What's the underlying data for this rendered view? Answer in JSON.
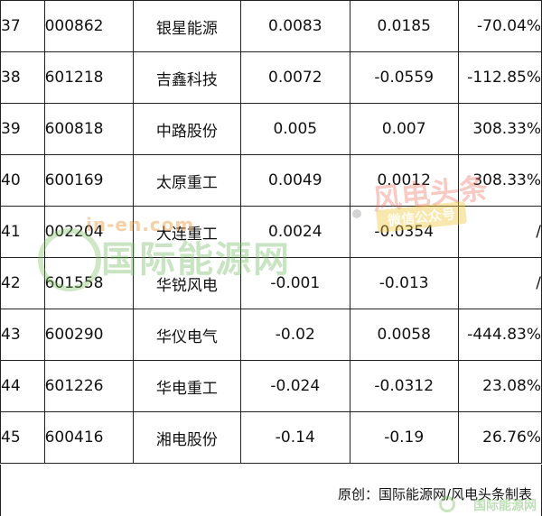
{
  "table": {
    "rows": [
      {
        "rank": "37",
        "code": "000862",
        "name": "银星能源",
        "v1": "0.0083",
        "v2": "0.0185",
        "change": "-70.04%"
      },
      {
        "rank": "38",
        "code": "601218",
        "name": "吉鑫科技",
        "v1": "0.0072",
        "v2": "-0.0559",
        "change": "-112.85%"
      },
      {
        "rank": "39",
        "code": "600818",
        "name": "中路股份",
        "v1": "0.005",
        "v2": "0.007",
        "change": "308.33%"
      },
      {
        "rank": "40",
        "code": "600169",
        "name": "太原重工",
        "v1": "0.0049",
        "v2": "0.0012",
        "change": "308.33%"
      },
      {
        "rank": "41",
        "code": "002204",
        "name": "大连重工",
        "v1": "0.0024",
        "v2": "-0.0354",
        "change": "/"
      },
      {
        "rank": "42",
        "code": "601558",
        "name": "华锐风电",
        "v1": "-0.001",
        "v2": "-0.013",
        "change": "/"
      },
      {
        "rank": "43",
        "code": "600290",
        "name": "华仪电气",
        "v1": "-0.02",
        "v2": "0.0058",
        "change": "-444.83%"
      },
      {
        "rank": "44",
        "code": "601226",
        "name": "华电重工",
        "v1": "-0.024",
        "v2": "-0.0312",
        "change": "23.08%"
      },
      {
        "rank": "45",
        "code": "600416",
        "name": "湘电股份",
        "v1": "-0.14",
        "v2": "-0.19",
        "change": "26.76%"
      }
    ]
  },
  "footer": {
    "source": "原创：国际能源网/风电头条制表"
  },
  "watermarks": {
    "site": "in-en.com",
    "name": "国际能源网",
    "brand": "风电头条",
    "badge": "微信公众号",
    "corner": "国际能源网"
  }
}
